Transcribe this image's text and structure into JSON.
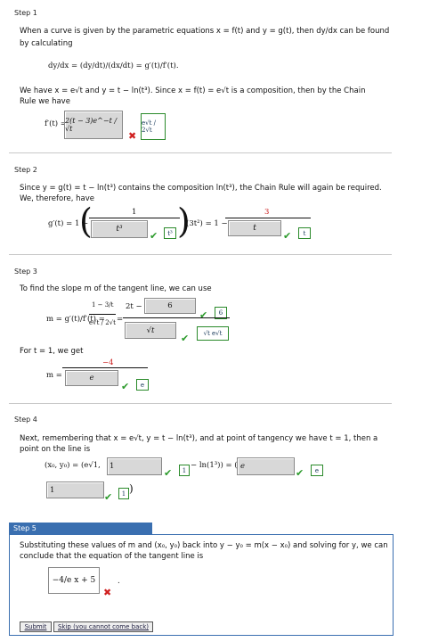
{
  "step1": {
    "label": "Step 1",
    "intro": "When a curve is given by the parametric equations x = f(t) and y = g(t), then dy/dx can be found",
    "intro2": "by calculating",
    "formula": "dy/dx = (dy/dt)/(dx/dt) = g′(t)/f′(t).",
    "have": "We have x = e√t and y = t − ln(t³). Since x = f(t) = e√t is a composition, then by the Chain",
    "have2": "Rule we have",
    "fprime_label": "f′(t) =",
    "answer_value": "2(t − 3)e^−t / √t",
    "correct_hint": "e√t / 2√t"
  },
  "step2": {
    "label": "Step 2",
    "text1": "Since y = g(t) = t − ln(t³) contains the composition ln(t³), the Chain Rule will again be required.",
    "text2": "We, therefore, have",
    "gprime_label": "g′(t) = 1 −",
    "num1": "1",
    "box1_value": "t³",
    "hint1": "t³",
    "mid": "(3t²) = 1 −",
    "num2": "3",
    "box2_value": "t",
    "hint2": "t"
  },
  "step3": {
    "label": "Step 3",
    "text1": "To find the slope m of the tangent line, we can use",
    "m_eq": "m = g′(t)/f′(t) =",
    "inner_num": "1 − 3/t",
    "inner_den": "e√t / 2√t",
    "eq": "=",
    "num_prefix": "2t −",
    "box1_value": "6",
    "hint1": "6",
    "box2_value": "√t",
    "hint2": "√t e√t",
    "for_t": "For t = 1, we get",
    "m_label": "m =",
    "num_red": "−4",
    "box3_value": "e",
    "hint3": "e"
  },
  "step4": {
    "label": "Step 4",
    "text1": "Next, remembering that x = e√t, y = t − ln(t³), and at point of tangency we have t = 1, then a",
    "text2": "point on the line is",
    "point_prefix": "(x₀, y₀) = (e√1,",
    "box1_value": "1",
    "hint1": "1",
    "mid": "− ln(1³)) = (",
    "box2_value": "e",
    "hint2": "e",
    "box3_value": "1",
    "hint3": "1"
  },
  "step5": {
    "label": "Step 5",
    "text1": "Substituting these values of m and (x₀, y₀) back into y − y₀ = m(x − x₀) and solving for y, we can",
    "text2": "conclude that the equation of the tangent line is",
    "answer_value": "−4/e x + 5"
  },
  "buttons": {
    "submit": "Submit",
    "skip": "Skip (you cannot come back)"
  },
  "colors": {
    "accent": "#3a6fb0",
    "correct": "#2b9a2b",
    "incorrect": "#d02020"
  }
}
